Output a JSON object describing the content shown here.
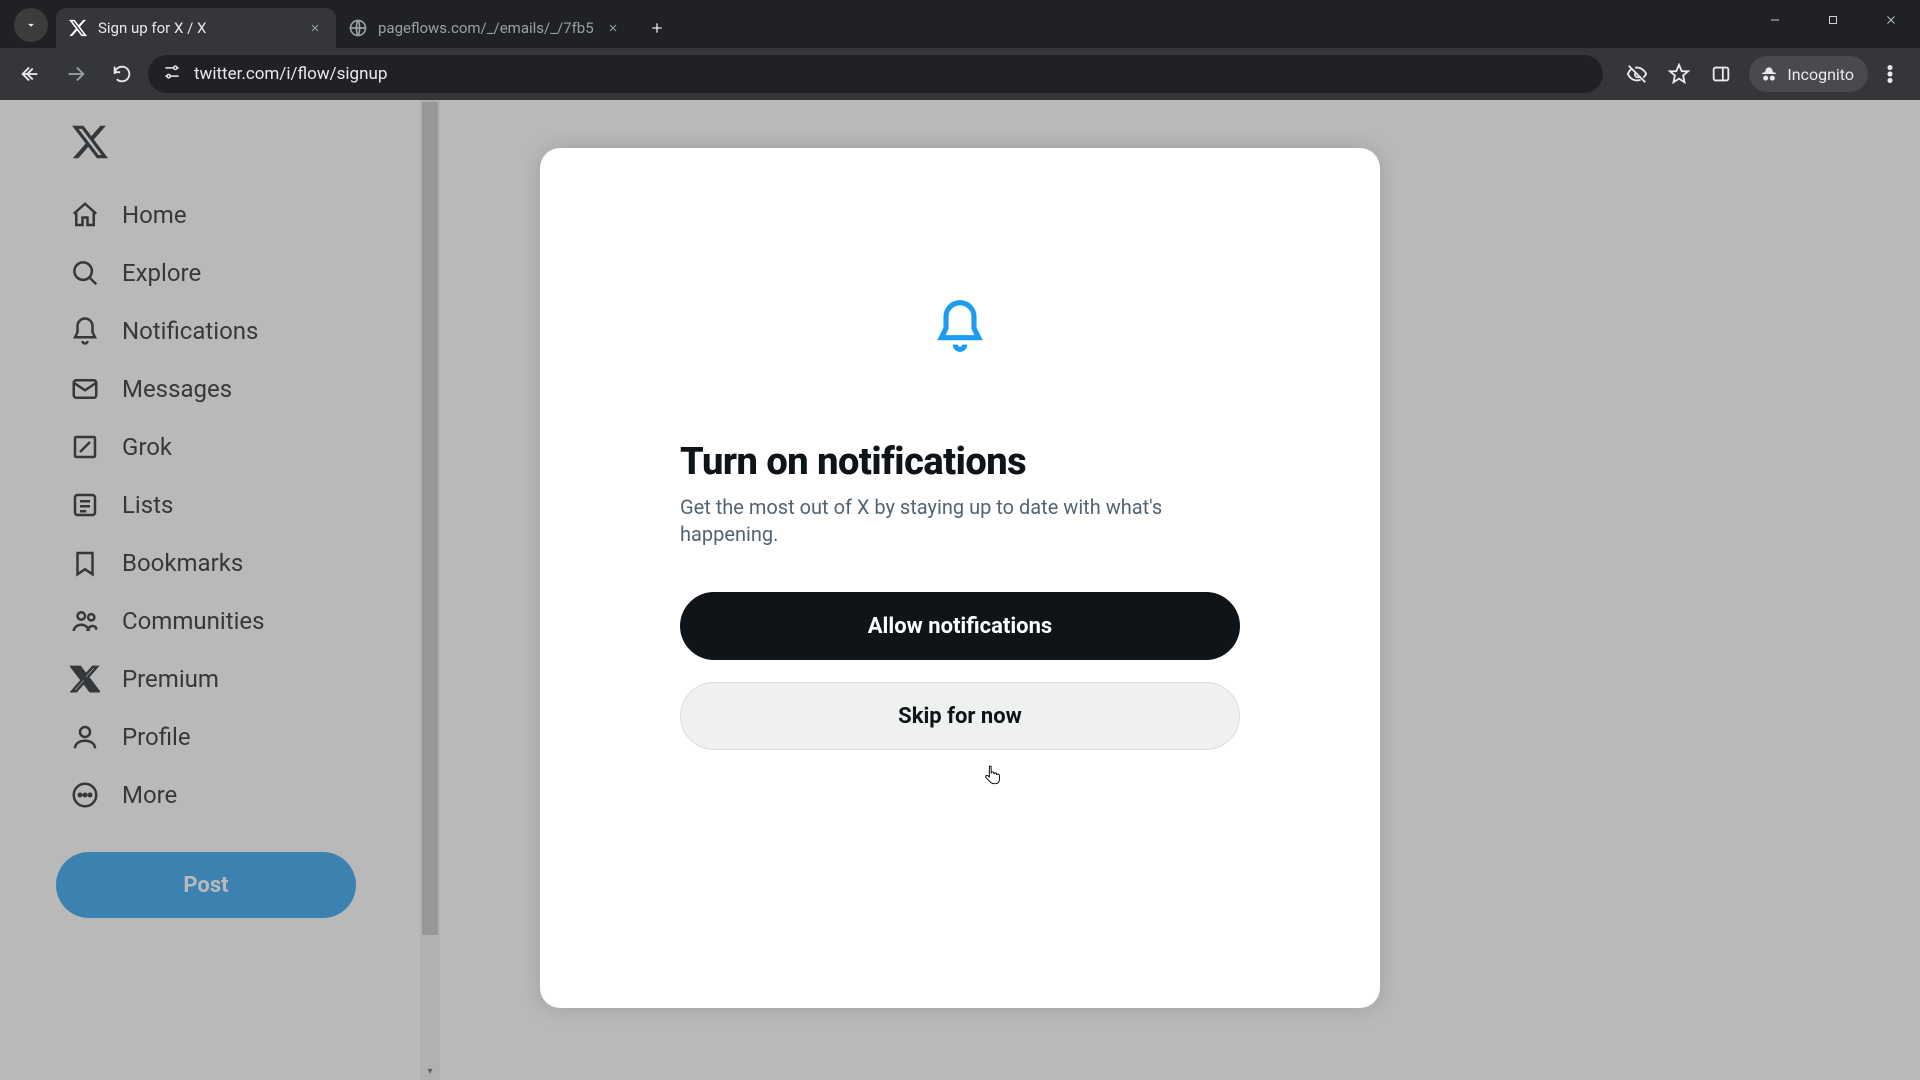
{
  "browser": {
    "tabs": [
      {
        "title": "Sign up for X / X",
        "active": true
      },
      {
        "title": "pageflows.com/_/emails/_/7fb5",
        "active": false
      }
    ],
    "url": "twitter.com/i/flow/signup",
    "incognito_label": "Incognito"
  },
  "sidebar": {
    "items": [
      {
        "label": "Home"
      },
      {
        "label": "Explore"
      },
      {
        "label": "Notifications"
      },
      {
        "label": "Messages"
      },
      {
        "label": "Grok"
      },
      {
        "label": "Lists"
      },
      {
        "label": "Bookmarks"
      },
      {
        "label": "Communities"
      },
      {
        "label": "Premium"
      },
      {
        "label": "Profile"
      },
      {
        "label": "More"
      }
    ],
    "post_label": "Post"
  },
  "modal": {
    "title": "Turn on notifications",
    "description": "Get the most out of X by staying up to date with what's happening.",
    "primary_label": "Allow notifications",
    "secondary_label": "Skip for now"
  }
}
